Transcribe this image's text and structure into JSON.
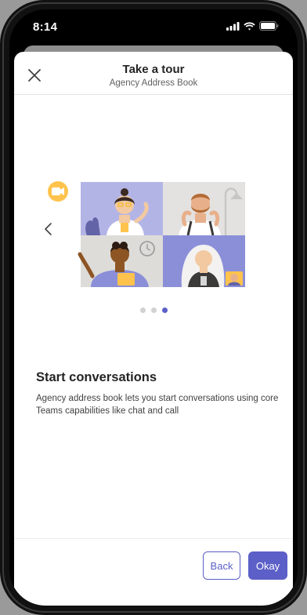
{
  "status_bar": {
    "time": "8:14",
    "icons": [
      "signal-icon",
      "wifi-icon",
      "battery-icon"
    ]
  },
  "header": {
    "title": "Take a tour",
    "subtitle": "Agency Address Book",
    "close_icon": "close-icon"
  },
  "carousel": {
    "prev_icon": "chevron-left-icon",
    "page_count": 3,
    "active_index": 2,
    "illustration": "video-call-illustration",
    "camera_icon": "video-camera-icon"
  },
  "slide": {
    "title": "Start conversations",
    "description": "Agency address book lets you start conversations using core Teams capabilities like chat and call"
  },
  "footer": {
    "back_label": "Back",
    "okay_label": "Okay"
  },
  "colors": {
    "accent": "#5b5fc7",
    "tile_purple": "#b3b4e6",
    "tile_grey": "#e4e2e0",
    "tile_dark_purple": "#8b8fd8"
  }
}
